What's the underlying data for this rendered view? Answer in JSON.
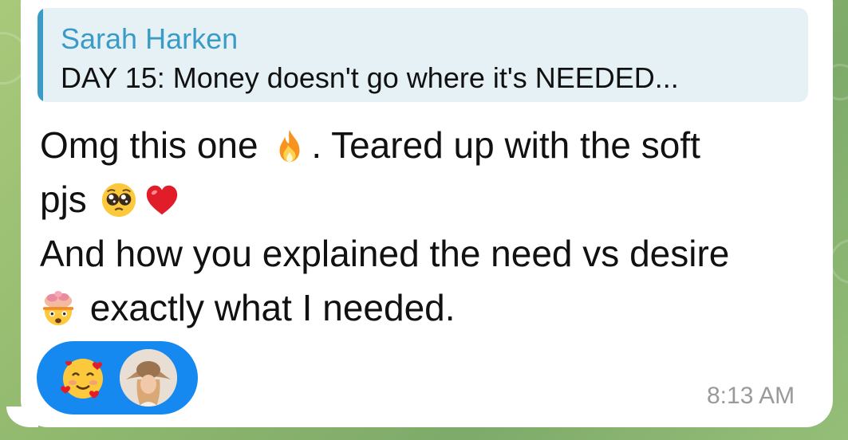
{
  "reply": {
    "author": "Sarah Harken",
    "preview": "DAY 15: Money doesn't go where it's NEEDED..."
  },
  "message": {
    "line1_a": "Omg this one ",
    "line1_b": ". Teared up with the soft",
    "line2_a": "pjs ",
    "line3": "And how you explained the need vs desire",
    "line4_b": " exactly what I needed."
  },
  "emojis": {
    "fire": "fire-icon",
    "pleading": "pleading-face-icon",
    "heart": "red-heart-icon",
    "exploding_head": "exploding-head-icon",
    "reaction": "smiling-face-with-hearts-icon"
  },
  "timestamp": "8:13 AM",
  "colors": {
    "accent": "#3a9cc6",
    "reply_background": "#e6f1f5",
    "reaction_pill": "#1689f0",
    "timestamp": "#9a9a9a"
  }
}
